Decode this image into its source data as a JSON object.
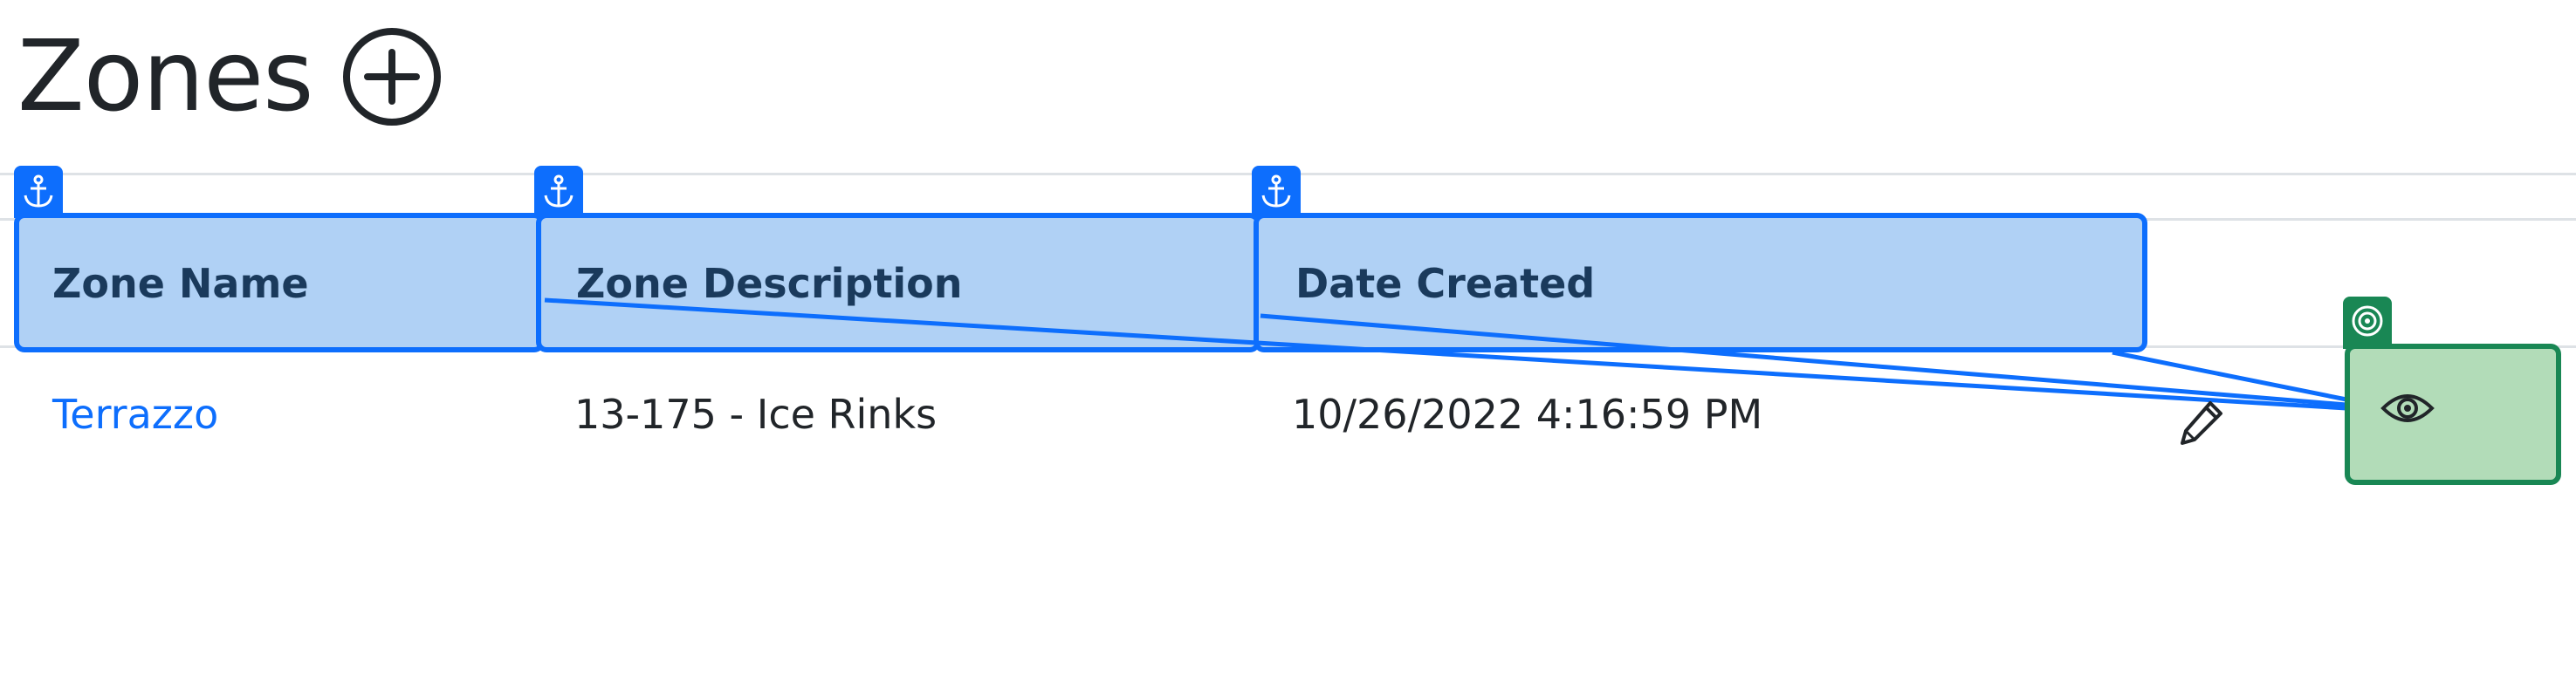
{
  "page": {
    "title": "Zones"
  },
  "table": {
    "headers": [
      "Zone Name",
      "Zone Description",
      "Date Created"
    ],
    "rows": [
      {
        "zone_name": "Terrazzo",
        "zone_description": "13-175 - Ice Rinks",
        "date_created": "10/26/2022 4:16:59 PM"
      }
    ]
  },
  "icons": {
    "add": "plus-circle-icon",
    "anchor": "anchor-icon",
    "edit": "pencil-icon",
    "target": "target-icon",
    "view": "eye-icon"
  },
  "colors": {
    "anchor_blue": "#0d6efd",
    "header_fill": "#b0d1f5",
    "target_green": "#198754",
    "target_fill": "#b2dcb8",
    "link": "#0d6efd"
  }
}
